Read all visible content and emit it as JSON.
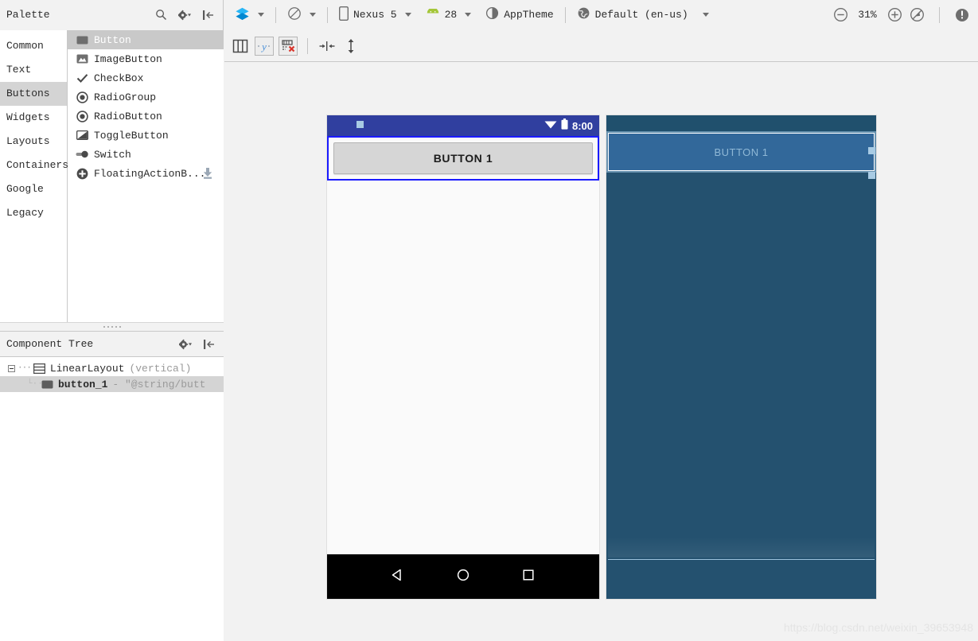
{
  "palette": {
    "title": "Palette",
    "search_icon": "search-icon",
    "gear_icon": "gear-icon",
    "collapse_icon": "collapse-panel-icon",
    "categories": [
      {
        "label": "Common",
        "selected": false
      },
      {
        "label": "Text",
        "selected": false
      },
      {
        "label": "Buttons",
        "selected": true
      },
      {
        "label": "Widgets",
        "selected": false
      },
      {
        "label": "Layouts",
        "selected": false
      },
      {
        "label": "Containers",
        "selected": false
      },
      {
        "label": "Google",
        "selected": false
      },
      {
        "label": "Legacy",
        "selected": false
      }
    ],
    "widgets": [
      {
        "label": "Button",
        "icon": "button-icon",
        "selected": true,
        "download": false
      },
      {
        "label": "ImageButton",
        "icon": "image-button-icon",
        "selected": false,
        "download": false
      },
      {
        "label": "CheckBox",
        "icon": "checkbox-icon",
        "selected": false,
        "download": false
      },
      {
        "label": "RadioGroup",
        "icon": "radio-group-icon",
        "selected": false,
        "download": false
      },
      {
        "label": "RadioButton",
        "icon": "radio-button-icon",
        "selected": false,
        "download": false
      },
      {
        "label": "ToggleButton",
        "icon": "toggle-button-icon",
        "selected": false,
        "download": false
      },
      {
        "label": "Switch",
        "icon": "switch-icon",
        "selected": false,
        "download": false
      },
      {
        "label": "FloatingActionB...",
        "icon": "floating-action-button-icon",
        "selected": false,
        "download": true
      }
    ]
  },
  "component_tree": {
    "title": "Component Tree",
    "gear_icon": "gear-icon",
    "collapse_icon": "collapse-panel-icon",
    "rows": [
      {
        "label": "LinearLayout",
        "sub": "(vertical)",
        "icon": "linear-layout-icon",
        "selected": false,
        "bold": false,
        "depth": 0
      },
      {
        "label": "button_1",
        "sub": "- \"@string/butt",
        "icon": "button-icon",
        "selected": true,
        "bold": true,
        "depth": 1
      }
    ]
  },
  "toolbar": {
    "design_mode_icon": "design-surface-icon",
    "orientation_icon": "orientation-icon",
    "device_icon": "phone-icon",
    "device": "Nexus 5",
    "api_icon": "android-icon",
    "api_level": "28",
    "theme_icon": "theme-icon",
    "theme": "AppTheme",
    "locale_icon": "globe-icon",
    "locale": "Default (en-us)",
    "zoom_out_icon": "zoom-out-icon",
    "zoom_level": "31%",
    "zoom_in_icon": "zoom-in-icon",
    "zoom_fit_icon": "zoom-to-fit-icon",
    "warning_icon": "error-badge-icon"
  },
  "editor_toolbar": {
    "buttons": [
      {
        "name": "show-constraints-icon",
        "label": "Show Constraints"
      },
      {
        "name": "autoconnect-icon",
        "label": "Autoconnect"
      },
      {
        "name": "clear-constraints-icon",
        "label": "Clear All Constraints"
      },
      {
        "name": "horizontal-margin-icon",
        "label": "Default Margins"
      },
      {
        "name": "vertical-align-icon",
        "label": "Pack / Align"
      }
    ]
  },
  "preview": {
    "status_bar": {
      "time": "8:00",
      "wifi_icon": "wifi-icon",
      "battery_icon": "battery-icon",
      "bg_color": "#303f9f"
    },
    "button_label": "BUTTON 1",
    "nav": [
      {
        "name": "nav-back-icon"
      },
      {
        "name": "nav-home-icon"
      },
      {
        "name": "nav-recents-icon"
      }
    ]
  },
  "blueprint": {
    "button_label": "BUTTON 1",
    "bg_color": "#24516f",
    "widget_color": "#32689a",
    "selection_color": "#a8cbe4"
  },
  "watermark": "https://blog.csdn.net/weixin_39653948"
}
